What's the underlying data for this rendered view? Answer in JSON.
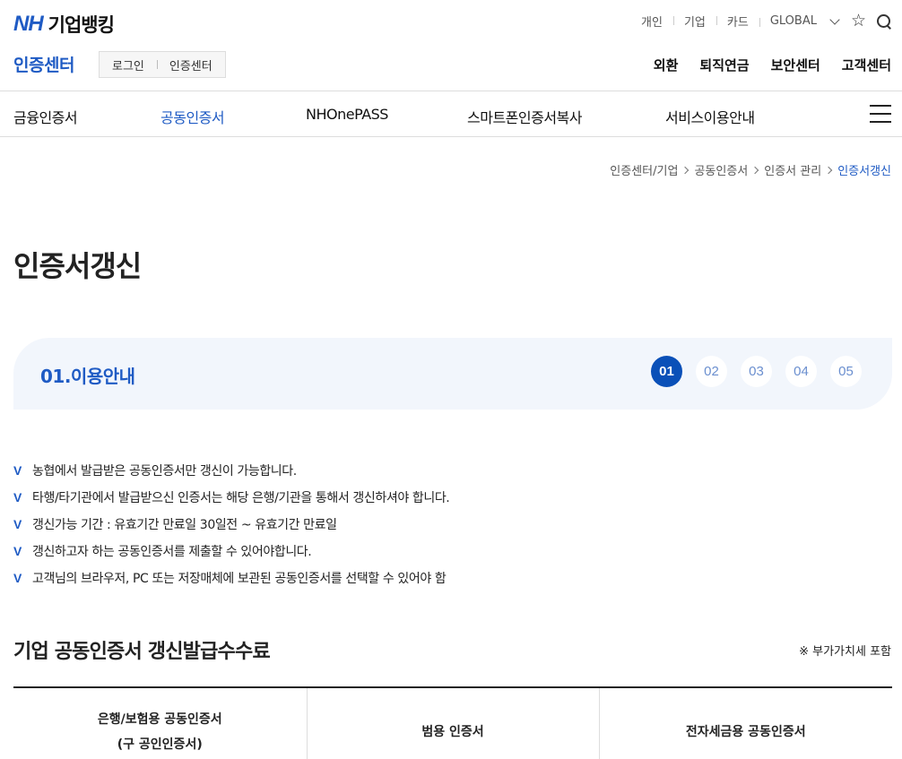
{
  "header": {
    "logo_nh": "NH",
    "logo_bank": "기업뱅킹",
    "util_links": [
      "개인",
      "기업",
      "카드",
      "GLOBAL"
    ],
    "center_title": "인증센터",
    "login_links": [
      "로그인",
      "인증센터"
    ],
    "services": [
      "외환",
      "퇴직연금",
      "보안센터",
      "고객센터"
    ]
  },
  "gnb": {
    "items": [
      "금융인증서",
      "공동인증서",
      "NHOnePASS",
      "스마트폰인증서복사",
      "서비스이용안내"
    ],
    "active": "공동인증서"
  },
  "breadcrumb": [
    "인증센터/기업",
    "공동인증서",
    "인증서 관리",
    "인증서갱신"
  ],
  "page_title": "인증서갱신",
  "step": {
    "label": "01.이용안내",
    "numbers": [
      "01",
      "02",
      "03",
      "04",
      "05"
    ],
    "current": "01"
  },
  "notes": [
    "농협에서 발급받은 공동인증서만 갱신이 가능합니다.",
    "타행/타기관에서 발급받으신 인증서는 해당 은행/기관을 통해서 갱신하셔야 합니다.",
    "갱신가능 기간 : 유효기간 만료일 30일전 ~ 유효기간 만료일",
    "갱신하고자 하는 공동인증서를 제출할 수 있어야합니다.",
    "고객님의 브라우저, PC 또는 저장매체에 보관된 공동인증서를 선택할 수 있어야 함"
  ],
  "check_mark": "V",
  "fee": {
    "title": "기업 공동인증서 갱신발급수수료",
    "note": "※ 부가가치세 포함",
    "columns": [
      {
        "line1": "은행/보험용 공동인증서",
        "line2": "(구 공인인증서)"
      },
      {
        "line1": "범용 인증서",
        "line2": ""
      },
      {
        "line1": "전자세금용 공동인증서",
        "line2": ""
      }
    ]
  },
  "colors": {
    "primary": "#1f5bc4",
    "step_active": "#0a50b8",
    "step_box_bg": "#f2f6fc"
  }
}
